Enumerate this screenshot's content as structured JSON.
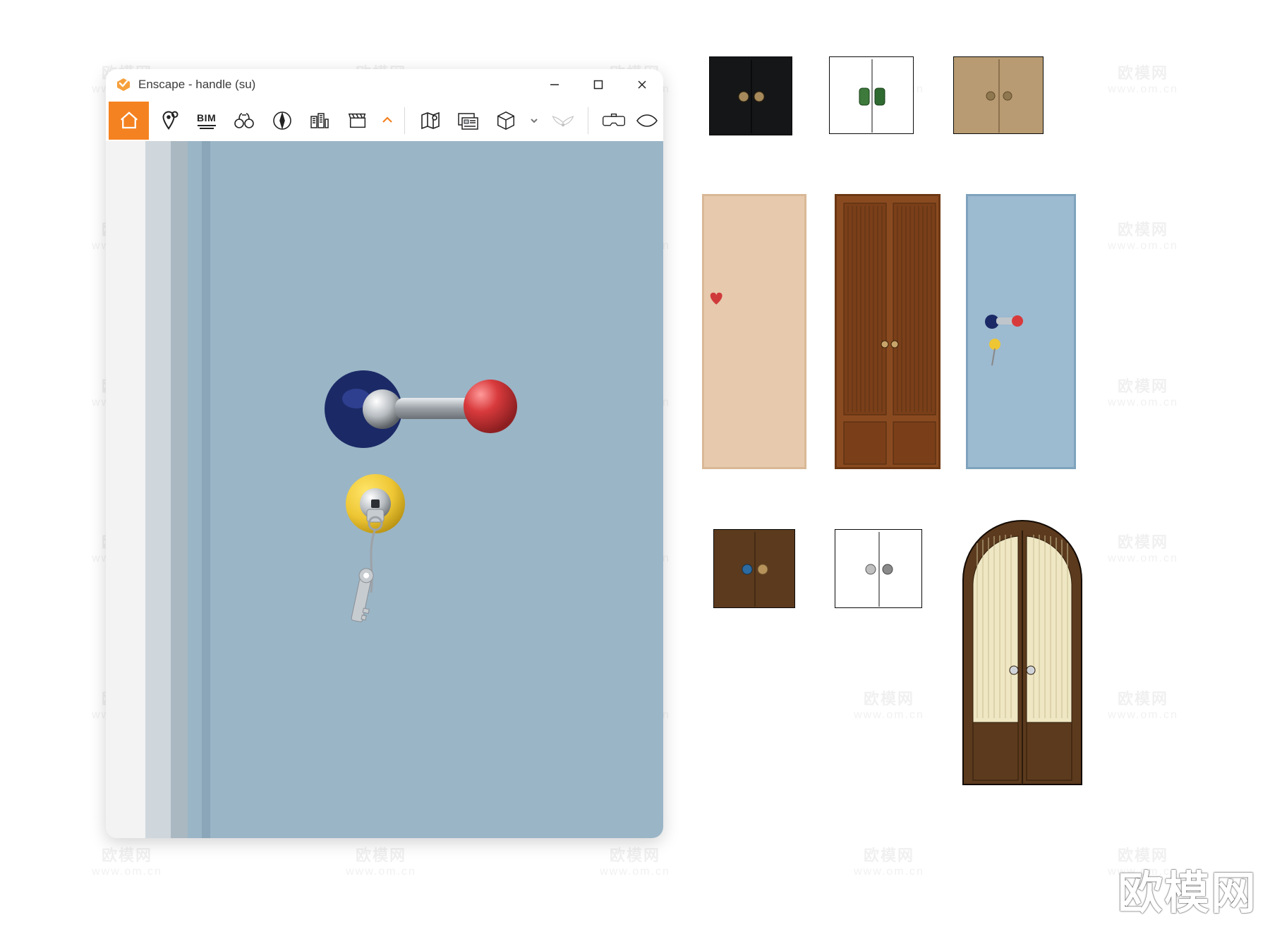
{
  "window": {
    "title": "Enscape - handle (su)",
    "toolbar": {
      "bim_label": "BIM"
    }
  },
  "watermark": {
    "brand_cn": "欧模网",
    "brand_url": "www.om.cn"
  },
  "logo_text": "欧模网",
  "icons": {
    "home": "home-icon",
    "pin": "map-pin-icon",
    "binoculars": "binoculars-icon",
    "compass": "compass-icon",
    "city": "buildings-icon",
    "clapper": "clapperboard-icon",
    "chevron": "chevron-down-icon",
    "map": "map-icon",
    "image_mgr": "image-manager-icon",
    "cube": "cube-icon",
    "reveal": "wings-icon",
    "vr": "vr-headset-icon",
    "eye": "eye-icon",
    "minimize": "minimize-icon",
    "maximize": "maximize-icon",
    "close": "close-icon",
    "app": "enscape-logo-icon"
  },
  "thumbnails": {
    "row1": [
      {
        "type": "cabinet",
        "fill": "#151617",
        "knob1": "#a78a5c",
        "knob2": "#a78a5c"
      },
      {
        "type": "cabinet",
        "fill": "#ffffff",
        "knob1": "#3d7a3b",
        "knob2": "#2f6a30",
        "knob_shape": "rect"
      },
      {
        "type": "cabinet",
        "fill": "#b89b72",
        "knob1": "#8f7750",
        "knob2": "#8f7750"
      }
    ],
    "row2": [
      {
        "type": "door",
        "fill": "#e7c9ad",
        "accent": "#cf3b3b",
        "accent_shape": "heart"
      },
      {
        "type": "double-door",
        "fill": "#8a4a20"
      },
      {
        "type": "door",
        "fill": "#9cbad0",
        "handle": true
      }
    ],
    "row3": [
      {
        "type": "cabinet",
        "fill": "#5c3a1d",
        "knob1": "#2c6aa0",
        "knob2": "#b7925a"
      },
      {
        "type": "cabinet",
        "fill": "#ffffff",
        "knob1": "#8a8a8a",
        "knob2": "#8a8a8a"
      },
      {
        "type": "arched",
        "fill": "#5c3a1d",
        "panel": "#efe7c3"
      }
    ]
  }
}
